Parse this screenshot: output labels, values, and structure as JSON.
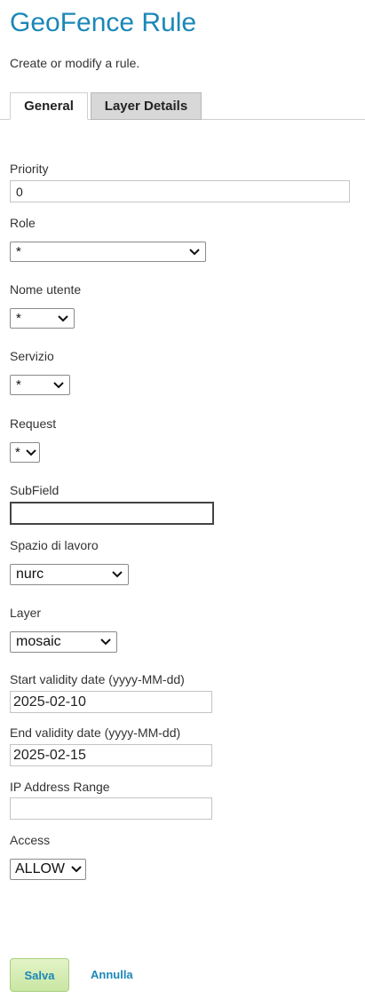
{
  "page": {
    "title": "GeoFence Rule",
    "subtitle": "Create or modify a rule."
  },
  "tabs": [
    {
      "label": "General",
      "active": true
    },
    {
      "label": "Layer Details",
      "active": false
    }
  ],
  "form": {
    "priority": {
      "label": "Priority",
      "value": "0"
    },
    "role": {
      "label": "Role",
      "value": "*"
    },
    "user": {
      "label": "Nome utente",
      "value": "*"
    },
    "service": {
      "label": "Servizio",
      "value": "*"
    },
    "request": {
      "label": "Request",
      "value": "*"
    },
    "subfield": {
      "label": "SubField",
      "value": ""
    },
    "workspace": {
      "label": "Spazio di lavoro",
      "value": "nurc"
    },
    "layer": {
      "label": "Layer",
      "value": "mosaic"
    },
    "start_date": {
      "label": "Start validity date (yyyy-MM-dd)",
      "value": "2025-02-10"
    },
    "end_date": {
      "label": "End validity date (yyyy-MM-dd)",
      "value": "2025-02-15"
    },
    "ip_range": {
      "label": "IP Address Range",
      "value": ""
    },
    "access": {
      "label": "Access",
      "value": "ALLOW"
    }
  },
  "actions": {
    "save_label": "Salva",
    "cancel_label": "Annulla"
  },
  "colors": {
    "title": "#1b87b8",
    "link": "#1b87b8",
    "save_bg": "#d6edb5"
  },
  "icons": {
    "dropdown": "chevron-down-icon"
  }
}
